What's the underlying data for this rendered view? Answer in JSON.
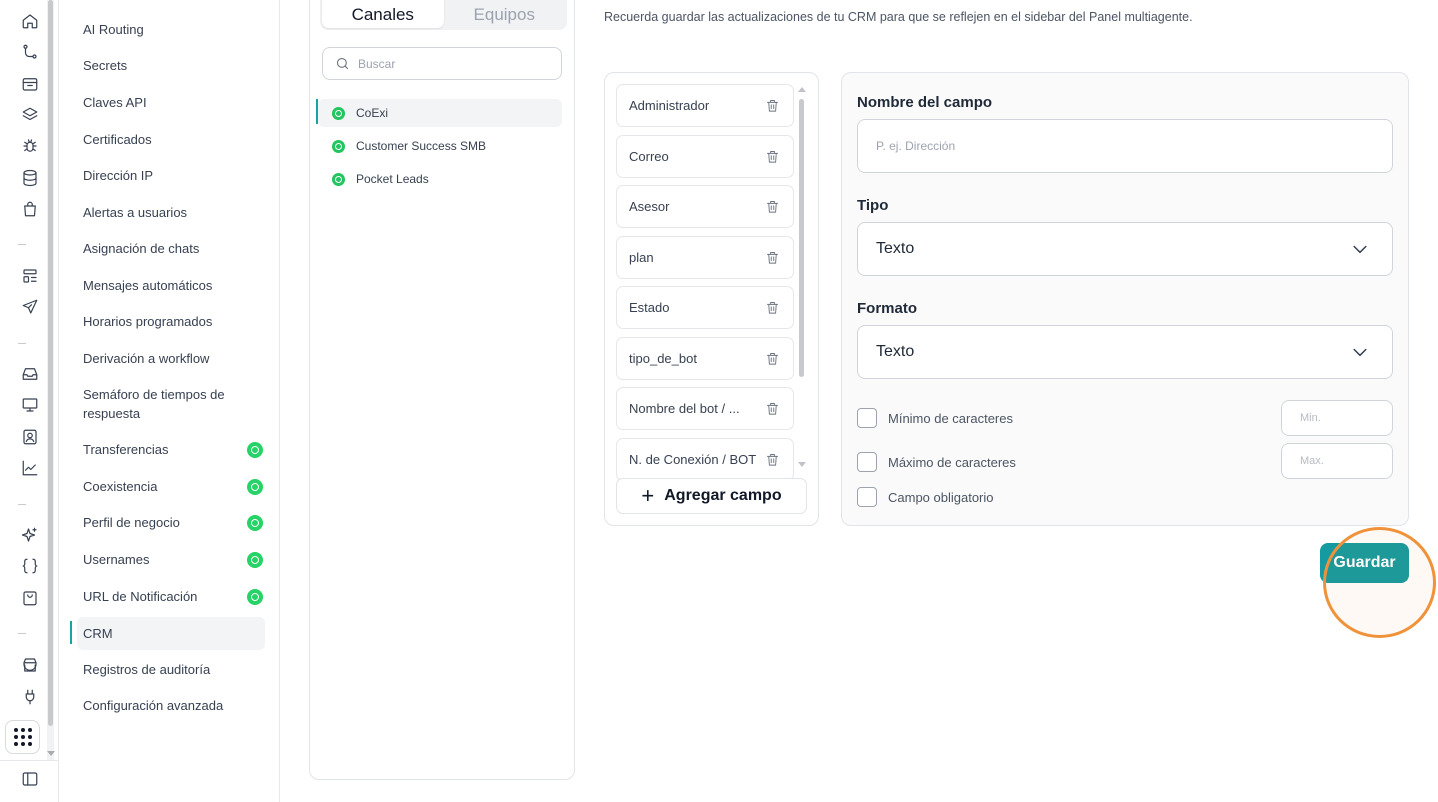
{
  "rail": {
    "icons": [
      "home-icon",
      "git-branch-icon",
      "archive-icon",
      "layers-icon",
      "bug-icon",
      "database-icon",
      "shopping-bag-icon",
      "layout-list-icon",
      "send-icon",
      "inbox-icon",
      "monitor-icon",
      "contact-icon",
      "chart-line-icon",
      "sparkles-icon",
      "braces-icon",
      "shopping-cart-icon",
      "store-icon",
      "plug-icon"
    ],
    "apps_icon": "apps-grid-icon",
    "sidebar_toggle_icon": "sidebar-toggle-icon"
  },
  "settings_nav": {
    "items": [
      {
        "label": "AI Routing",
        "whatsapp": false,
        "active": false
      },
      {
        "label": "Secrets",
        "whatsapp": false,
        "active": false
      },
      {
        "label": "Claves API",
        "whatsapp": false,
        "active": false
      },
      {
        "label": "Certificados",
        "whatsapp": false,
        "active": false
      },
      {
        "label": "Dirección IP",
        "whatsapp": false,
        "active": false
      },
      {
        "label": "Alertas a usuarios",
        "whatsapp": false,
        "active": false
      },
      {
        "label": "Asignación de chats",
        "whatsapp": false,
        "active": false
      },
      {
        "label": "Mensajes automáticos",
        "whatsapp": false,
        "active": false
      },
      {
        "label": "Horarios programados",
        "whatsapp": false,
        "active": false
      },
      {
        "label": "Derivación a workflow",
        "whatsapp": false,
        "active": false
      },
      {
        "label": "Semáforo de tiempos de respuesta",
        "whatsapp": false,
        "active": false
      },
      {
        "label": "Transferencias",
        "whatsapp": true,
        "active": false
      },
      {
        "label": "Coexistencia",
        "whatsapp": true,
        "active": false
      },
      {
        "label": "Perfil de negocio",
        "whatsapp": true,
        "active": false
      },
      {
        "label": "Usernames",
        "whatsapp": true,
        "active": false
      },
      {
        "label": "URL de Notificación",
        "whatsapp": true,
        "active": false
      },
      {
        "label": "CRM",
        "whatsapp": false,
        "active": true
      },
      {
        "label": "Registros de auditoría",
        "whatsapp": false,
        "active": false
      },
      {
        "label": "Configuración avanzada",
        "whatsapp": false,
        "active": false
      }
    ]
  },
  "channels_panel": {
    "tabs": [
      {
        "label": "Canales",
        "active": true
      },
      {
        "label": "Equipos",
        "active": false
      }
    ],
    "search_placeholder": "Buscar",
    "channels": [
      {
        "label": "CoExi",
        "active": true
      },
      {
        "label": "Customer Success SMB",
        "active": false
      },
      {
        "label": "Pocket Leads",
        "active": false
      }
    ]
  },
  "main": {
    "subtitle": "Recuerda guardar las actualizaciones de tu CRM para que se reflejen en el sidebar del Panel multiagente.",
    "fields": [
      "Administrador",
      "Correo",
      "Asesor",
      "plan",
      "Estado",
      "tipo_de_bot",
      "Nombre del bot / ...",
      "N. de Conexión / BOT"
    ],
    "add_field_label": "Agregar campo",
    "form": {
      "name_label": "Nombre del campo",
      "name_placeholder": "P. ej. Dirección",
      "name_value": "",
      "type_label": "Tipo",
      "type_value": "Texto",
      "format_label": "Formato",
      "format_value": "Texto",
      "min_label": "Mínimo de caracteres",
      "min_placeholder": "Min.",
      "max_label": "Máximo de caracteres",
      "max_placeholder": "Max.",
      "required_label": "Campo obligatorio"
    },
    "save_label": "Guardar"
  },
  "colors": {
    "accent": "#149aa0",
    "whatsapp": "#25d366",
    "highlight": "#f0923a"
  }
}
